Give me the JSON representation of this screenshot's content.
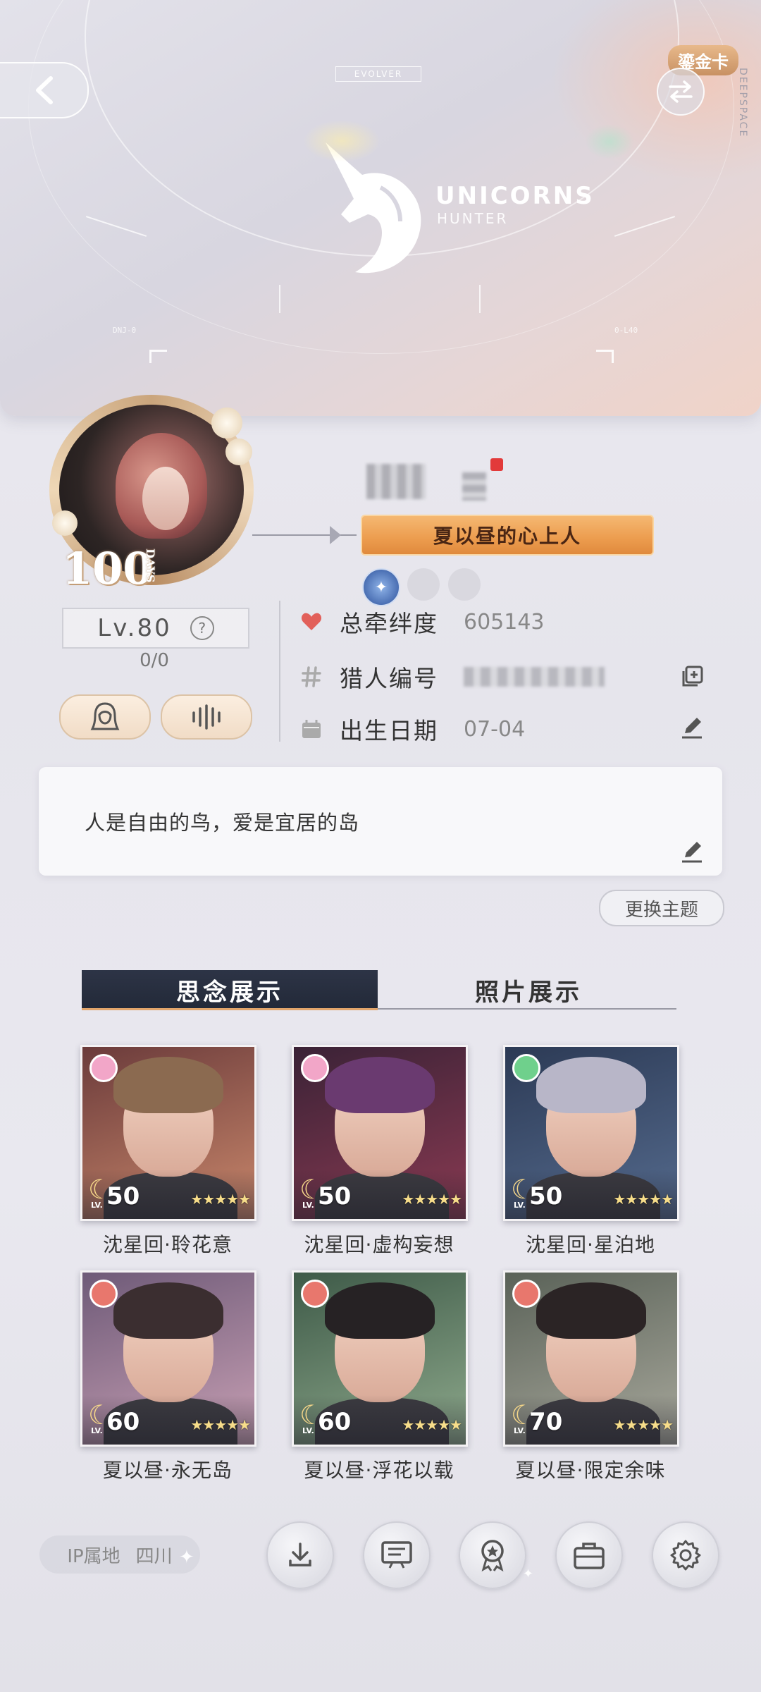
{
  "hero": {
    "evolver_tag": "EVOLVER",
    "logo_title": "UNICORNS",
    "logo_subtitle": "HUNTER",
    "hud_left": "DNJ-0",
    "hud_right": "0-L40",
    "side_brand": "DEEPSPACE",
    "card_badge": "鎏金卡"
  },
  "profile": {
    "days_number": "100",
    "days_word": "DAYS",
    "title_banner": "夏以昼的心上人",
    "level": "Lv.80",
    "level_progress": "0/0",
    "help_glyph": "?"
  },
  "info": {
    "bond_label": "总牵绊度",
    "bond_value": "605143",
    "hunter_id_label": "猎人编号",
    "birthday_label": "出生日期",
    "birthday_value": "07-04"
  },
  "signature": {
    "text": "人是自由的鸟，爱是宜居的岛",
    "change_theme": "更换主题"
  },
  "tabs": [
    {
      "label": "思念展示",
      "active": true
    },
    {
      "label": "照片展示",
      "active": false
    }
  ],
  "cards": [
    {
      "label": "沈星回·聆花意",
      "level": "50",
      "lv_prefix": "LV.",
      "gem_color": "#f2a6c8",
      "bg_top": "#6b3b3b",
      "bg_bottom": "#c9876b",
      "hair": "#8b6a50",
      "stars": "★★★★★"
    },
    {
      "label": "沈星回·虚构妄想",
      "level": "50",
      "lv_prefix": "LV.",
      "gem_color": "#f2a6c8",
      "bg_top": "#3a2236",
      "bg_bottom": "#8a3a52",
      "hair": "#6a3a70",
      "stars": "★★★★★"
    },
    {
      "label": "沈星回·星泊地",
      "level": "50",
      "lv_prefix": "LV.",
      "gem_color": "#6fd08c",
      "bg_top": "#2c3a55",
      "bg_bottom": "#556b8e",
      "hair": "#b8b6c8",
      "stars": "★★★★★"
    },
    {
      "label": "夏以昼·永无岛",
      "level": "60",
      "lv_prefix": "LV.",
      "gem_color": "#e8776d",
      "bg_top": "#6e5a78",
      "bg_bottom": "#c8a0b4",
      "hair": "#3b2e30",
      "stars": "★★★★★"
    },
    {
      "label": "夏以昼·浮花以载",
      "level": "60",
      "lv_prefix": "LV.",
      "gem_color": "#e8776d",
      "bg_top": "#3e5a48",
      "bg_bottom": "#8ea98c",
      "hair": "#262224",
      "stars": "★★★★★"
    },
    {
      "label": "夏以昼·限定余味",
      "level": "70",
      "lv_prefix": "LV.",
      "gem_color": "#e8776d",
      "bg_top": "#5a6258",
      "bg_bottom": "#a8a89c",
      "hair": "#2b2425",
      "stars": "★★★★★"
    }
  ],
  "footer": {
    "ip_label": "IP属地",
    "ip_value": "四川"
  },
  "icons": {
    "back": "chevron-left-icon",
    "swap": "swap-arrows-icon",
    "heart": "heart-icon",
    "hash": "hash-icon",
    "calendar": "calendar-icon",
    "copy": "copy-icon",
    "edit": "pencil-icon",
    "portrait": "portrait-icon",
    "voice": "voice-wave-icon",
    "download": "download-icon",
    "board": "board-icon",
    "award": "award-icon",
    "briefcase": "briefcase-icon",
    "settings": "gear-icon"
  },
  "colors": {
    "accent_orange": "#ec9c4e",
    "heart_red": "#e2605a",
    "tab_dark": "#2d3446"
  }
}
